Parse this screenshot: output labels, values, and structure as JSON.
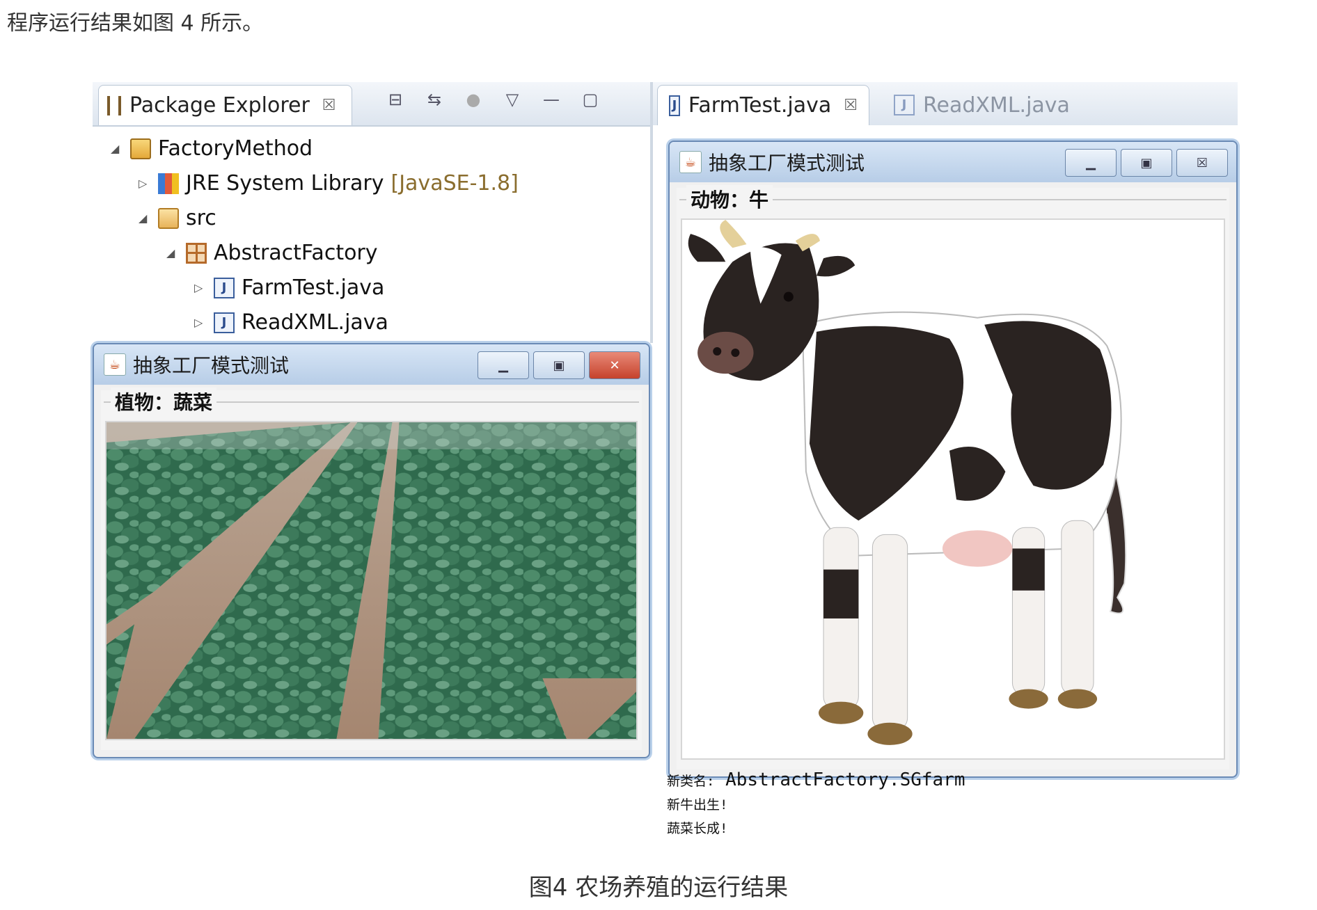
{
  "intro_text": "程序运行结果如图 4 所示。",
  "caption": "图4 农场养殖的运行结果",
  "package_explorer": {
    "tab_label": "Package Explorer",
    "tab_close": "☒",
    "tree": [
      {
        "label": "FactoryMethod",
        "icon": "project-folder-icon",
        "expanded": true
      },
      {
        "label": "JRE System Library",
        "suffix": "[JavaSE-1.8]",
        "icon": "library-icon",
        "expanded": false
      },
      {
        "label": "src",
        "icon": "source-folder-icon",
        "expanded": true
      },
      {
        "label": "AbstractFactory",
        "icon": "package-icon",
        "expanded": true
      },
      {
        "label": "FarmTest.java",
        "icon": "java-file-icon",
        "expanded": false
      },
      {
        "label": "ReadXML.java",
        "icon": "java-file-icon",
        "expanded": false
      }
    ]
  },
  "editor_tabs": [
    {
      "label": "FarmTest.java",
      "active": true,
      "close": "☒"
    },
    {
      "label": "ReadXML.java",
      "active": false
    }
  ],
  "plant_window": {
    "title": "抽象工厂模式测试",
    "group_label": "植物：蔬菜",
    "image": "vegetable-field"
  },
  "animal_window": {
    "title": "抽象工厂模式测试",
    "group_label": "动物：牛",
    "image": "cow"
  },
  "console": {
    "line1_prefix": "新类名:",
    "line1_value": "AbstractFactory.SGfarm",
    "line2": "新牛出生!",
    "line3": "蔬菜长成!"
  },
  "colors": {
    "title_bar": "#c4d8ee",
    "close_button": "#c5422c",
    "window_border": "#6a8ab5"
  }
}
